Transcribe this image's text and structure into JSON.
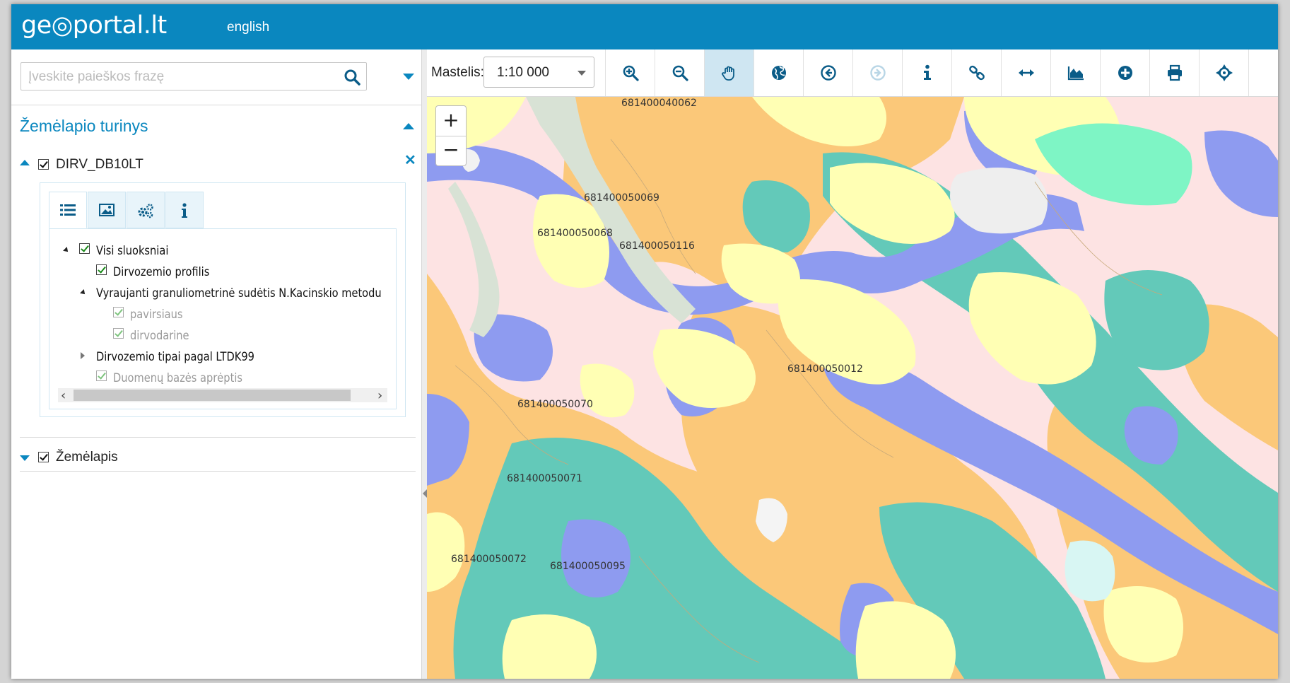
{
  "header": {
    "logo": "ge◎portal.lt",
    "language": "english"
  },
  "search": {
    "placeholder": "Įveskite paieškos frazę",
    "value": ""
  },
  "contents": {
    "title": "Žemėlapio turinys",
    "layers": [
      {
        "name": "DIRV_DB10LT",
        "checked": true,
        "expanded": true
      },
      {
        "name": "Žemėlapis",
        "checked": true,
        "expanded": false
      }
    ],
    "tree": [
      {
        "label": "Visi sluoksniai",
        "checked": true
      },
      {
        "label": "Dirvozemio profilis",
        "checked": true
      },
      {
        "label": "Vyraujanti granuliometrinė sudėtis N.Kacinskio metodu"
      },
      {
        "label": "pavirsiaus",
        "checked": true
      },
      {
        "label": "dirvodarine",
        "checked": true
      },
      {
        "label": "Dirvozemio tipai pagal LTDK99"
      },
      {
        "label": "Duomenų bazės aprėptis",
        "checked": true
      }
    ]
  },
  "toolbar": {
    "scale_label": "Mastelis:",
    "scale_value": "1:10 000",
    "tools": [
      "zoom-in",
      "zoom-out",
      "pan",
      "globe",
      "previous-extent",
      "next-extent",
      "info",
      "link",
      "measure",
      "profile",
      "add",
      "print",
      "locate"
    ]
  },
  "map": {
    "zoom_in": "+",
    "zoom_out": "−",
    "parcels": [
      "681400040062",
      "681400050069",
      "681400050068",
      "681400050116",
      "681400050012",
      "681400050070",
      "681400050071",
      "681400050072",
      "681400050095"
    ]
  },
  "colors": {
    "header": "#0a87bf",
    "sand_orange": "#fbc879",
    "light_yellow": "#ffffb4",
    "pink": "#fde3e3",
    "teal": "#63c9b9",
    "blue": "#8e9bf0",
    "mint": "#7ef5c5",
    "grey_green": "#d8e2d5"
  }
}
